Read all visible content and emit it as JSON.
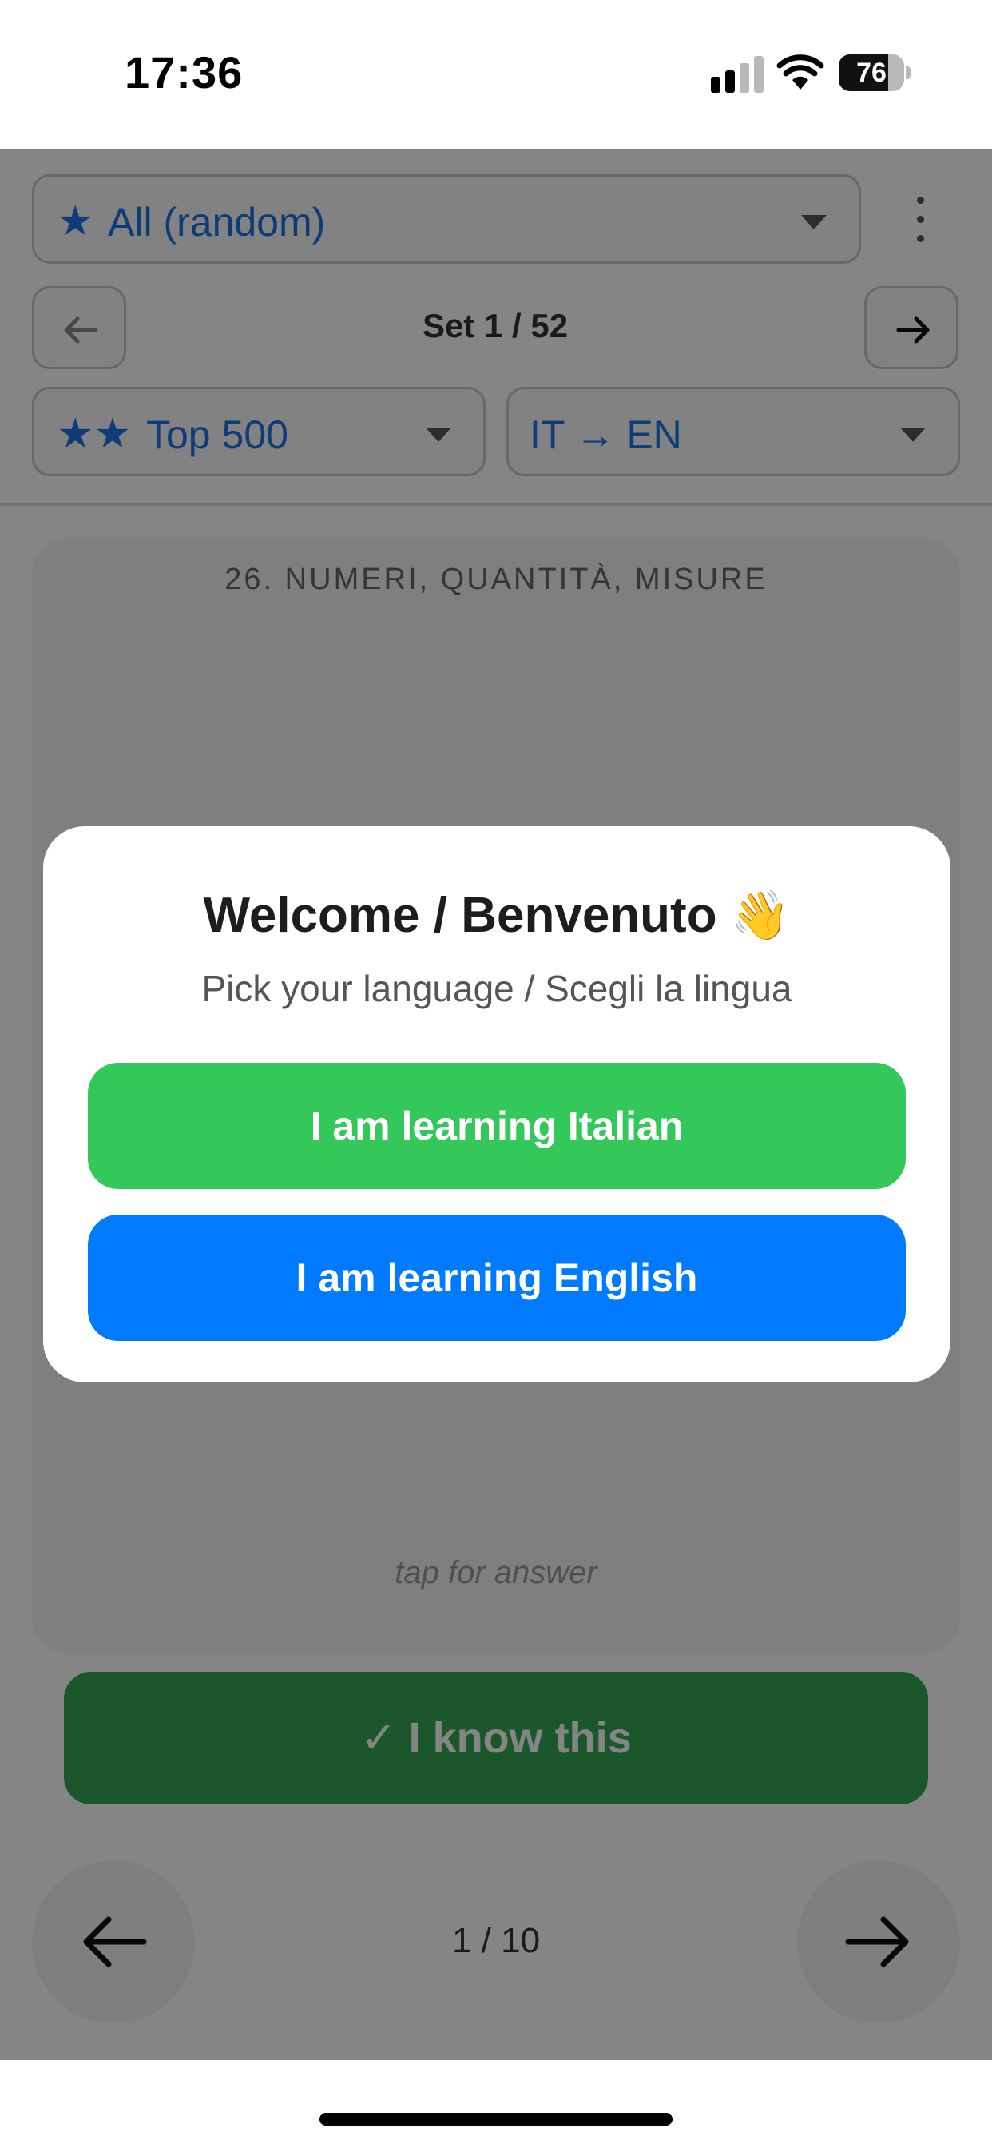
{
  "status_bar": {
    "time": "17:36",
    "battery_level": "76",
    "battery_fraction": 0.76
  },
  "header": {
    "deck_select": {
      "stars": "★",
      "label": "All (random)"
    },
    "set_label": "Set 1 / 52",
    "level_select": {
      "stars": "★★",
      "label": "Top 500"
    },
    "direction_select": {
      "label": "IT → EN"
    }
  },
  "card": {
    "category": "26. NUMERI, QUANTITÀ, MISURE",
    "hint": "tap for answer"
  },
  "know_button": "✓ I know this",
  "footer": {
    "counter": "1 / 10"
  },
  "modal": {
    "title": "Welcome / Benvenuto",
    "title_emoji": "👋",
    "subtitle": "Pick your language / Scegli la lingua",
    "italian_button": "I am learning Italian",
    "english_button": "I am learning English"
  },
  "colors": {
    "accent_blue": "#1a73e8",
    "green": "#34c759",
    "blue": "#007aff"
  }
}
